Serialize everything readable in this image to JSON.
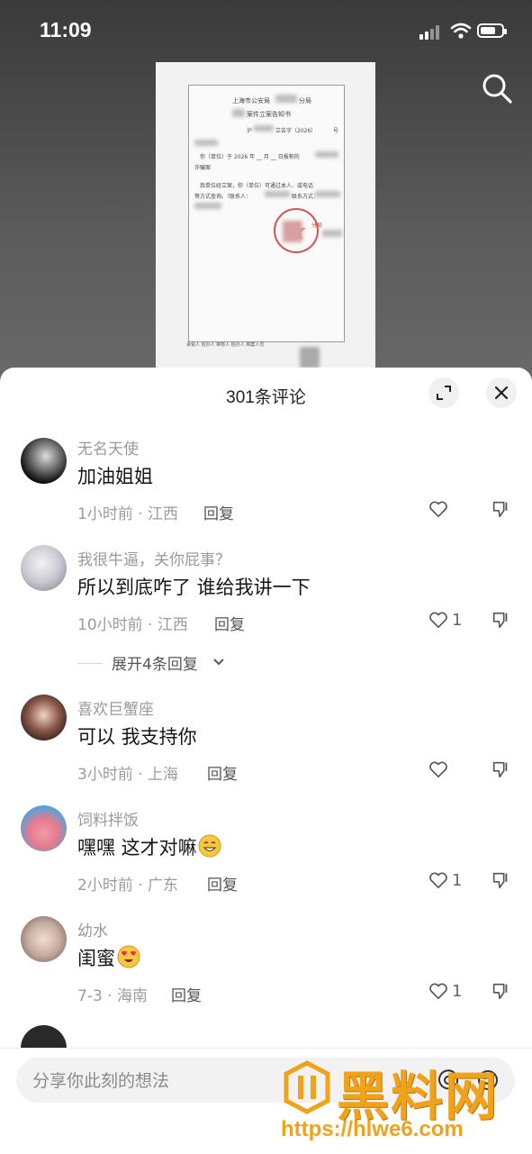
{
  "status_bar": {
    "time": "11:09"
  },
  "document": {
    "heading_1": "上海市公安局",
    "heading_1b": "分局",
    "heading_2": "案件立案告知书",
    "ref_line": "沪",
    "ref_mid": "立告字〔2026〕",
    "ref_end": "号",
    "body_1": "你（单位）于 2026 年 __ 月 __ 日报称的",
    "body_2": "诈骗案",
    "body_3": "我单位经立案，你（单位）可通过本人、或电话",
    "body_4": "等方式查询。（联系人：",
    "body_4b": "联系方式：",
    "seal_text": "分局",
    "footer": "承受人    经办人    审核人    经办人   档案人员"
  },
  "comments_sheet": {
    "title": "301条评论",
    "comments": [
      {
        "name": "无名天使",
        "text": "加油姐姐",
        "meta": "1小时前 · 江西",
        "reply": "回复",
        "likes": ""
      },
      {
        "name": "我很牛逼，关你屁事？",
        "text": "所以到底咋了 谁给我讲一下",
        "meta": "10小时前 · 江西",
        "reply": "回复",
        "likes": "1",
        "expand": "展开4条回复"
      },
      {
        "name": "喜欢巨蟹座",
        "text": "可以 我支持你",
        "meta": "3小时前 · 上海",
        "reply": "回复",
        "likes": ""
      },
      {
        "name": "饲料拌饭",
        "text": "嘿嘿 这才对嘛",
        "meta": "2小时前 · 广东",
        "reply": "回复",
        "likes": "1"
      },
      {
        "name": "幼水",
        "text": "闺蜜",
        "meta": "7-3 · 海南",
        "reply": "回复",
        "likes": "1"
      }
    ]
  },
  "input": {
    "placeholder": "分享你此刻的想法"
  },
  "watermark": {
    "text": "黑料网",
    "url": "https://hlwe6.com"
  },
  "colors": {
    "accent_orange": "#f0a21a",
    "heart_stroke": "#555555"
  },
  "icons": [
    "search-icon",
    "expand-icon",
    "close-icon",
    "heart-icon",
    "dislike-icon",
    "chevron-down-icon",
    "emoji-icon",
    "mention-icon"
  ]
}
